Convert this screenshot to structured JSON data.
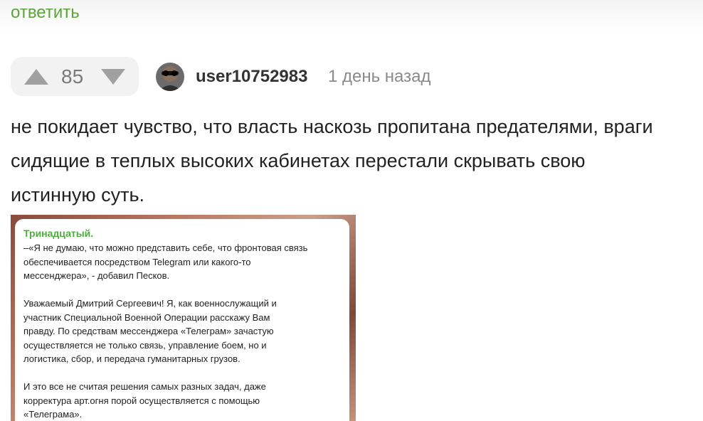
{
  "comment_top": {
    "reply_label": "ответить"
  },
  "comment": {
    "rating": "85",
    "username": "user10752983",
    "timestamp": "1 день назад",
    "text_lines": [
      "не покидает чувство, что власть наскозь пропитана предателями, враги",
      "сидящие в теплых высоких кабинетах перестали скрывать свою",
      "истинную суть."
    ],
    "colors": {
      "accent_green": "#5aa63a",
      "vote_box_bg": "#f2f2f2",
      "arrow_gray": "#a0a0a0"
    },
    "icons": {
      "upvote": "triangle-up-icon",
      "downvote": "triangle-down-icon"
    }
  },
  "embedded_post": {
    "author": "Тринадцатый.",
    "lines": [
      "–«Я не думаю, что можно представить себе, что фронтовая связь",
      "обеспечивается посредством Telegram или какого-то",
      "мессенджера», - добавил Песков.",
      "",
      "Уважаемый Дмитрий Сергеевич! Я, как военнослужащий и",
      "участник Специальной Военной Операции расскажу Вам",
      "правду. По средствам мессенджера «Телеграм» зачастую",
      "осуществляется  не только связь, управление боем, но и",
      "логистика, сбор, и передача гуманитарных грузов.",
      "",
      "И это все не считая решения самых разных задач, даже",
      "корректура арт.огня порой осуществляется с помощью",
      "«Телеграма»."
    ]
  }
}
